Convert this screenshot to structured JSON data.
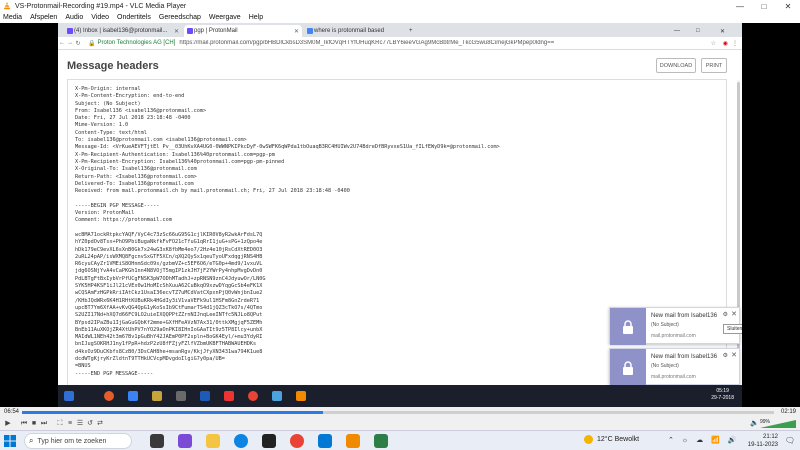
{
  "vlc": {
    "title": "VS-Protonmail-Recording #19.mp4 - VLC Media Player",
    "menu": [
      "Media",
      "Afspelen",
      "Audio",
      "Video",
      "Ondertitels",
      "Gereedschap",
      "Weergave",
      "Help"
    ],
    "time_elapsed": "06:54",
    "time_total": "02:19",
    "seek_progress": 0.4,
    "volume": "99%"
  },
  "browser": {
    "tabs": [
      {
        "label": "(4) Inbox | isabel136@protonmail..."
      },
      {
        "label": "pgp | ProtonMail"
      },
      {
        "label": "where is protonmail based"
      }
    ],
    "active_tab": 1,
    "secure_label": "Proton Technologies AG [CH]",
    "url": "https://mail.protonmail.com/pgp/bHBDlCkbsD3SM0M_IkfOVqHTYfUHuqKRc77LBY6ieeVGAg9McBbtrMe_TkcG5wu8CimejGkPMpep0ldng=="
  },
  "page": {
    "title": "Message headers",
    "download_label": "DOWNLOAD",
    "print_label": "PRINT",
    "header_lines": [
      "X-Pm-Origin: internal",
      "X-Pm-Content-Encryption: end-to-end",
      "Subject: (No Subject)",
      "From: Isabel136 <isabel136@protonmail.com>",
      "Date: Fri, 27 Jul 2018 23:18:48 -0400",
      "Mime-Version: 1.0",
      "Content-Type: text/html",
      "To: isabel136@protonmail.com <isabel136@protonmail.com>",
      "Message-Id: <VrKueAEVFTjtEl Pv__03UhKvXA4UG0-0WWNPKIPkcDyF-0wSWFK6qWPda1tbOuaqB3RC4HUIWv2U74BdreDfBRyvxeS1Ua_fILfEWyD9k=@protonmail.com>",
      "X-Pm-Recipient-Authentication: Isabel136%40protonmail.com=pgp-pm",
      "X-Pm-Recipient-Encryption: Isabel136%40protonmail.com=pgp-pm-pinned",
      "X-Original-To: Isabel136@protonmail.com",
      "Return-Path: <Isabel136@protonmail.com>",
      "Delivered-To: Isabel136@protonmail.com",
      "Received: from mail.protonmail.ch by mail.protonmail.ch; Fri, 27 Jul 2018 23:18:48 -0400",
      "",
      "-----BEGIN PGP MESSAGE-----",
      "Version: ProtonMail",
      "Comment: https://protonmail.com",
      "",
      "wcBMA71ockRtpkcYAQF/VyC4c73zSc66uG95G1cjlKIR0V8yR2wkArFdsL7Q",
      "hYZ0pdOv8Tsx+PhO9PbiBugaNkfkFvFO21cTfuG1qRrI1juG+sPG+1zQpo4e",
      "hDk179eC9evXL6sXnB0Gk7x24wG3xK8fbMm4eo7/2Hz4e10jRsCdXtRED0O3",
      "2uRL24pAP/isWXMQ8FgcnvSxGTF5XCn/qXQ2QySx1qeuTyoUFxdqgjRNS4HB",
      "R6cyuCAyZr1VMEiS8OHnmSdc09s/gzbmVZ+c5EF6O6/eTG0p+4md9/1vxuVL",
      "jdg6OSNjYvA4vCaPKGh1nn4N8VOjT5mgIP1zkJH7jF2YWrPy4nhpMvgDvDn0",
      "PdLBTgFtBxIybVrPfUCgFNSK3pW7ODhMTadhJ+zpRNSN9znC4JdyuwOr/LN0G",
      "SYK5HP4KSF1iJl21cVEx0w1HoMIcShXuuA62CuBkqO9xzwDYqgGcSb4eFK1X",
      "wCQSAmFzHGPkRriIAtCkz1UsaI36ecvTZ7uMCdVatCXpxnPjQ0vWnjbnIue2",
      "/KHbJQdWRx6K4H1RHtKUBuKRk4HGdIy3iV1vaVEFk9ul1HSFm8GnZrdeR71",
      "upcBT7Ym6XfAA+vKvQG4QpG1yKoSsIb9CtFumarTS4d1jQZ3cTkO7s/4QTmo",
      "S2UZI17Nd+hXQ7d66FC9LO2uieIXQQPPtZZrnNIJnqLeeINTfc5NJLo8QPut",
      "BYpsd2IPaZBu1IjGaGuGQbKf2mme+GXfHFeAVzN7Ax31/0ttkXMgjqF5ZEMh",
      "BnEb11AuXKOjZR4XtUhPV7nYO29aOnPKI8IHnIoGAaTIt9z5TP8Ilcy+unbX",
      "MAIdWL1NEh42t3m67Bv1pGuBhY42JAEmP0PF2spln+BoGK4Eyl/+mu3YdyRI",
      "bnIJugSOKRHJ1ny1fPpR+hdzP2zU8fFZjyFZlfVZbmUKBFTHABWAUEHDKs",
      "d4ksOz9DuCKbfs8CzB0/3DsCAH8he+msanRgv/KkjJfyXN3431wa794K1ue8",
      "dcdWTgKjryKrZldtnT9TTHkUCVcpMDvgdoIlgiG7y0pa/UB=",
      "=BNUS",
      "-----END PGP MESSAGE-----"
    ]
  },
  "notifications": [
    {
      "title": "New mail from Isabel136",
      "subtitle": "(No Subject)",
      "source": "mail.protonmail.com",
      "tooltip": "Sluiten"
    },
    {
      "title": "New mail from Isabel136",
      "subtitle": "(No Subject)",
      "source": "mail.protonmail.com"
    }
  ],
  "inner_clock": {
    "time": "05:19",
    "date": "29-7-2018"
  },
  "taskbar": {
    "search_placeholder": "Typ hier om te zoeken",
    "weather": "12°C Bewolkt",
    "time": "21:12",
    "date": "19-11-2023"
  },
  "colors": {
    "accent": "#2c7be5",
    "proton_purple": "#8f92c8",
    "vlc_orange": "#f08a00",
    "volume_green": "#3aa04f"
  }
}
